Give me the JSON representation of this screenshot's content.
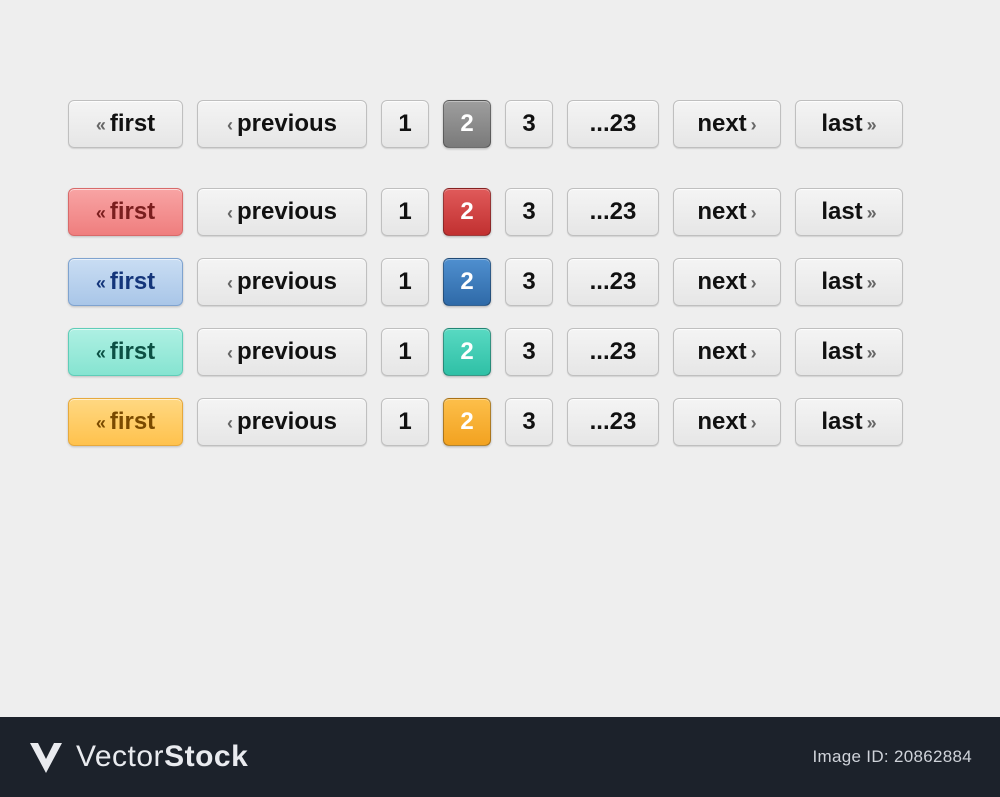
{
  "labels": {
    "first": "first",
    "previous": "previous",
    "page1": "1",
    "page2": "2",
    "page3": "3",
    "ellipsis": "...23",
    "next": "next",
    "last": "last"
  },
  "glyphs": {
    "dbl_left": "«",
    "dbl_right": "»",
    "single_left": "‹",
    "single_right": "›"
  },
  "variants": [
    {
      "name": "gray",
      "active_class": "gray",
      "first_hover_class": ""
    },
    {
      "name": "red",
      "active_class": "red",
      "first_hover_class": "red"
    },
    {
      "name": "blue",
      "active_class": "blue",
      "first_hover_class": "blue"
    },
    {
      "name": "teal",
      "active_class": "teal",
      "first_hover_class": "teal"
    },
    {
      "name": "orange",
      "active_class": "orange",
      "first_hover_class": "orange"
    }
  ],
  "footer": {
    "brand_thin": "Vector",
    "brand_bold": "Stock",
    "image_id": "Image ID: 20862884"
  }
}
